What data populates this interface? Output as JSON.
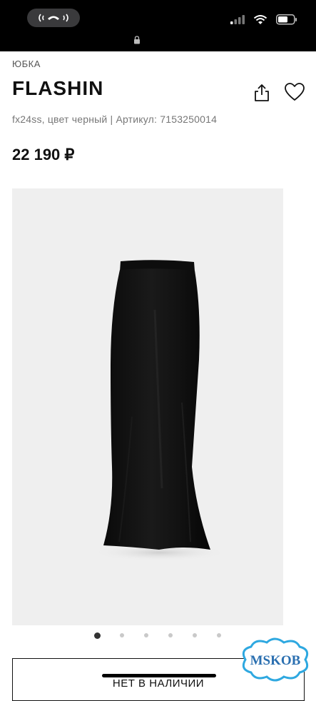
{
  "status_bar": {
    "call_icon": "phone-handset-icon",
    "signal_icon": "cellular-signal-icon",
    "wifi_icon": "wifi-icon",
    "battery_icon": "battery-icon",
    "lock_icon": "lock-icon"
  },
  "product": {
    "category": "ЮБКА",
    "brand": "FLASHIN",
    "meta": "fx24ss, цвет черный | Артикул: 7153250014",
    "price": "22 190 ₽",
    "image_icon": "black-maxi-skirt-photo"
  },
  "actions": {
    "share_icon": "share-icon",
    "favorite_icon": "heart-icon"
  },
  "carousel": {
    "total": 6,
    "active_index": 0
  },
  "stock_button": {
    "label": "НЕТ В НАЛИЧИИ"
  },
  "watermark": {
    "text": "MSKOB"
  },
  "colors": {
    "status_bar_bg": "#000000",
    "image_bg": "#efefef",
    "skirt": "#111111",
    "watermark_outline": "#2ea8e0"
  }
}
